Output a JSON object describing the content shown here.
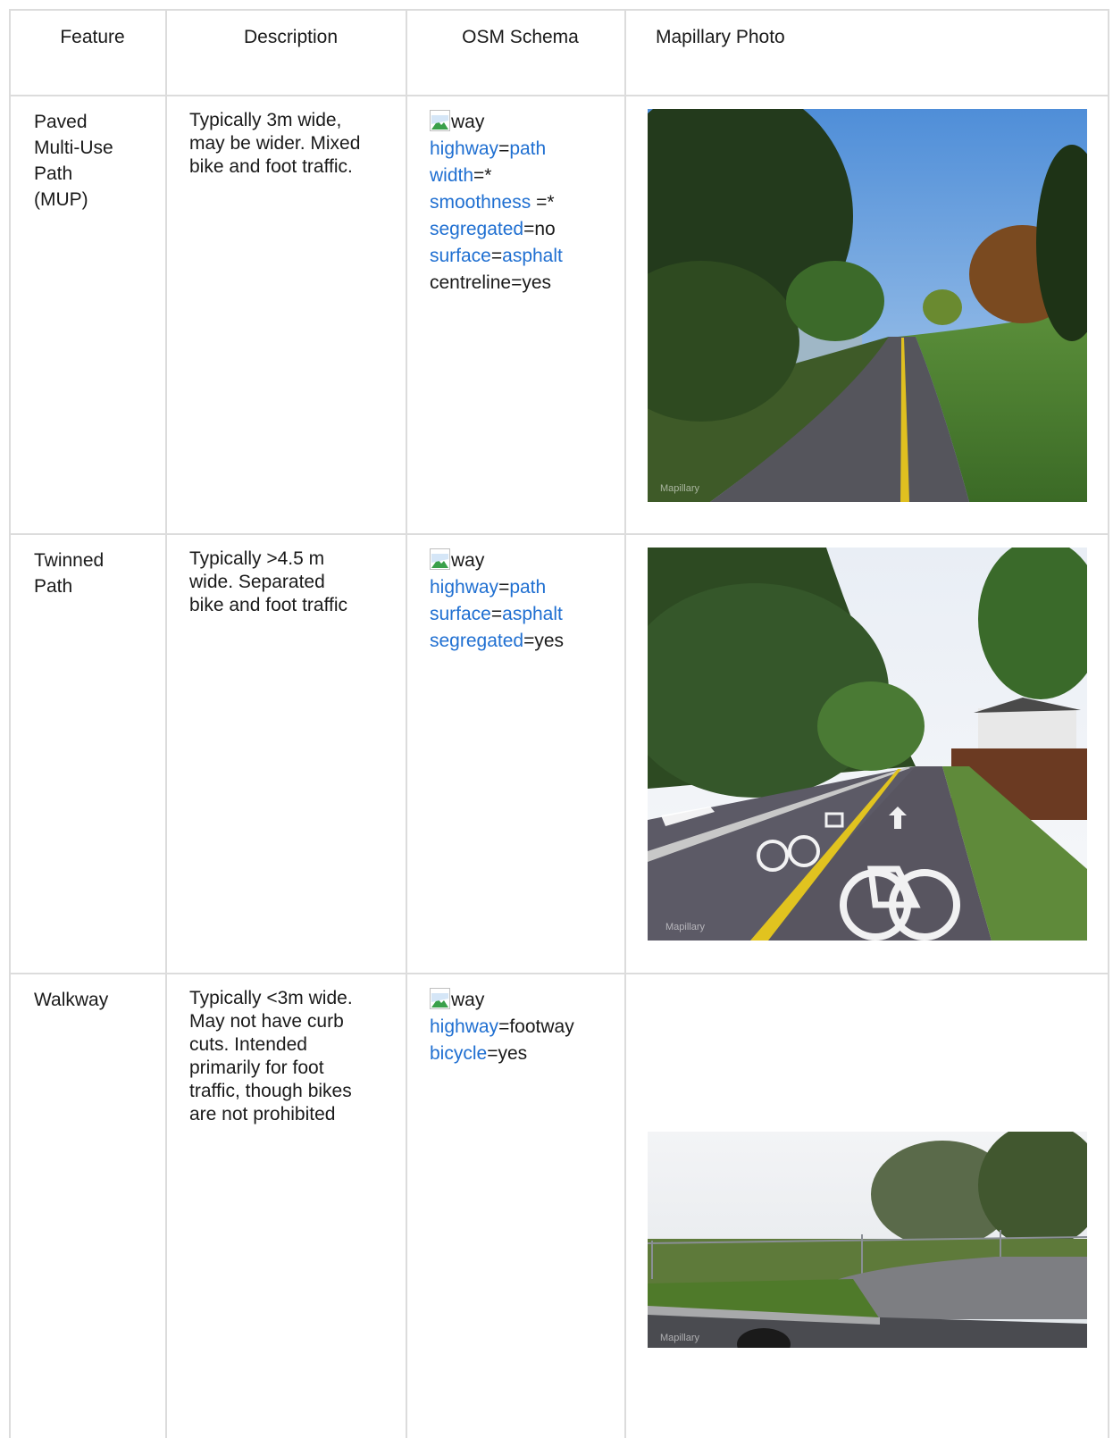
{
  "headers": {
    "feature": "Feature",
    "description": "Description",
    "osm_schema": "OSM Schema",
    "photo": "Mapillary Photo"
  },
  "rows": [
    {
      "feature_lines": [
        "Paved",
        "Multi-Use",
        "Path",
        "(MUP)"
      ],
      "description_lines": [
        "Typically 3m wide,",
        "may be wider. Mixed",
        "bike and foot traffic."
      ],
      "way_label": "way",
      "tags": [
        {
          "key": "highway",
          "eq": "=",
          "value": "path",
          "value_link": true
        },
        {
          "key": "width",
          "eq": "=*",
          "value": "",
          "value_link": false
        },
        {
          "key": "smoothness",
          "eq": " =*",
          "value": "",
          "value_link": false
        },
        {
          "key": "segregated",
          "eq": "=",
          "value": "no",
          "value_link": false
        },
        {
          "key": "surface",
          "eq": "=",
          "value": "asphalt",
          "value_link": true
        },
        {
          "key": "centreline",
          "eq": "=",
          "value": "yes",
          "value_link": false,
          "key_plain": true
        }
      ],
      "photo_watermark": "Mapillary"
    },
    {
      "feature_lines": [
        "Twinned",
        "Path"
      ],
      "description_lines": [
        "Typically >4.5 m",
        "wide. Separated",
        "bike and foot traffic"
      ],
      "way_label": "way",
      "tags": [
        {
          "key": "highway",
          "eq": "=",
          "value": "path",
          "value_link": true
        },
        {
          "key": "surface",
          "eq": "=",
          "value": "asphalt",
          "value_link": true
        },
        {
          "key": "segregated",
          "eq": "=",
          "value": "yes",
          "value_link": false
        }
      ],
      "photo_watermark": "Mapillary"
    },
    {
      "feature_lines": [
        "Walkway"
      ],
      "description_lines": [
        "Typically <3m wide.",
        "May not have curb",
        "cuts. Intended",
        "primarily for foot",
        "traffic, though bikes",
        "are not prohibited"
      ],
      "way_label": "way",
      "tags": [
        {
          "key": "highway",
          "eq": "=",
          "value": "footway",
          "value_link": false
        },
        {
          "key": "bicycle",
          "eq": "=",
          "value": "yes",
          "value_link": false
        }
      ],
      "photo_watermark": "Mapillary"
    }
  ],
  "colors": {
    "link": "#1f6fd1",
    "border": "#dcdcdc",
    "text": "#1a1a1a"
  },
  "icons": {
    "broken_image": "broken-image-icon"
  }
}
